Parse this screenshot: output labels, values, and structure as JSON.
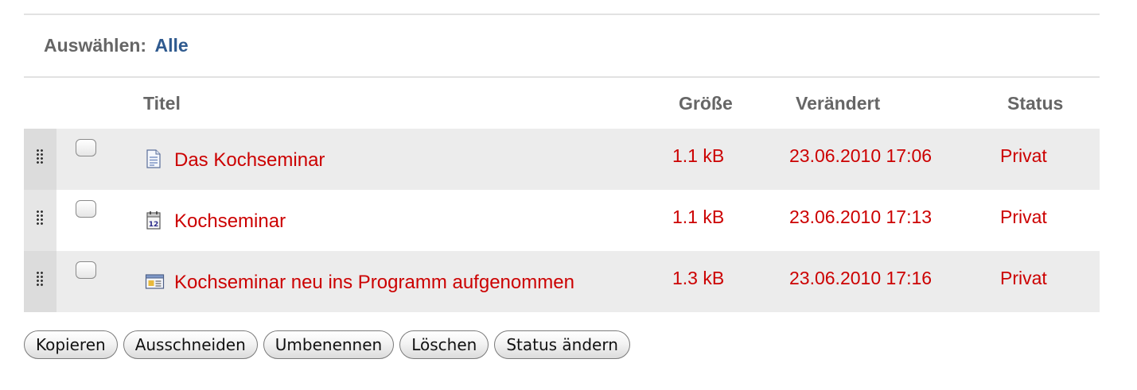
{
  "select_bar": {
    "label": "Auswählen:",
    "all_link": "Alle"
  },
  "table": {
    "columns": {
      "title": "Titel",
      "size": "Größe",
      "modified": "Verändert",
      "status": "Status"
    },
    "rows": [
      {
        "icon": "document-icon",
        "title": "Das Kochseminar",
        "size": "1.1 kB",
        "modified": "23.06.2010 17:06",
        "status": "Privat",
        "checked": false
      },
      {
        "icon": "event-calendar-icon",
        "title": "Kochseminar",
        "size": "1.1 kB",
        "modified": "23.06.2010 17:13",
        "status": "Privat",
        "checked": false
      },
      {
        "icon": "news-item-icon",
        "title": "Kochseminar neu ins Programm aufgenommen",
        "size": "1.3 kB",
        "modified": "23.06.2010 17:16",
        "status": "Privat",
        "checked": false
      }
    ]
  },
  "actions": {
    "copy": "Kopieren",
    "cut": "Ausschneiden",
    "rename": "Umbenennen",
    "delete": "Löschen",
    "change_state": "Status ändern"
  },
  "colors": {
    "link_red": "#cc0000",
    "link_blue": "#2f5a8f",
    "header_gray": "#666666",
    "row_shade": "#ececec"
  }
}
